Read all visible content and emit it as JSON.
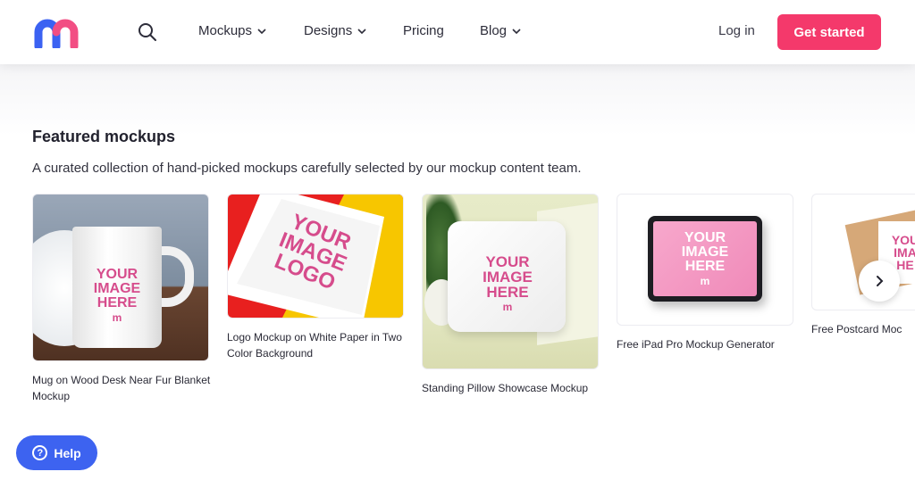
{
  "header": {
    "nav": [
      {
        "label": "Mockups"
      },
      {
        "label": "Designs"
      },
      {
        "label": "Pricing"
      },
      {
        "label": "Blog"
      }
    ],
    "login_label": "Log in",
    "cta_label": "Get started"
  },
  "section": {
    "title": "Featured mockups",
    "subtitle": "A curated collection of hand-picked mockups carefully selected by our mockup content team."
  },
  "cards": [
    {
      "caption": "Mug on Wood Desk Near Fur Blanket Mockup",
      "placeholder": [
        "YOUR",
        "IMAGE",
        "HERE"
      ]
    },
    {
      "caption": "Logo Mockup on White Paper in Two Color Background",
      "placeholder": [
        "YOUR",
        "IMAGE",
        "LOGO"
      ]
    },
    {
      "caption": "Standing Pillow Showcase Mockup",
      "placeholder": [
        "YOUR",
        "IMAGE",
        "HERE"
      ]
    },
    {
      "caption": "Free iPad Pro Mockup Generator",
      "placeholder": [
        "YOUR",
        "IMAGE",
        "HERE"
      ]
    },
    {
      "caption": "Free Postcard Moc",
      "placeholder": [
        "YOU",
        "IMA",
        "HE"
      ]
    }
  ],
  "help": {
    "label": "Help",
    "glyph": "?"
  },
  "icons": {
    "logo": "logo-m-icon",
    "search": "search-icon",
    "chevron": "chevron-down-icon",
    "next": "chevron-right-icon",
    "placeholder_mark": "m"
  },
  "colors": {
    "accent": "#f4396b",
    "help": "#3d63f0",
    "logo_blue": "#3b62f2",
    "logo_pink": "#f24e83",
    "placeholder": "#d64c8c"
  }
}
